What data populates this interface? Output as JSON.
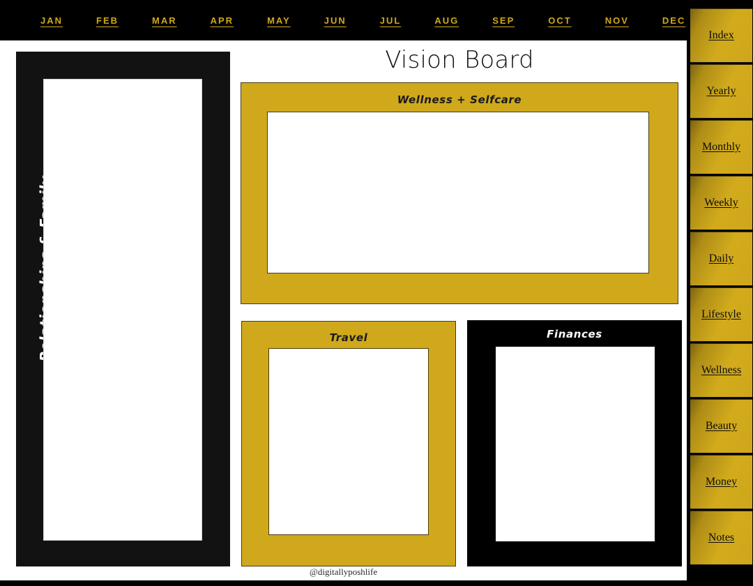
{
  "page": {
    "title": "Vision Board",
    "credit": "@digitallyposhlife"
  },
  "colors": {
    "gold": "#CFA81C",
    "gold_dark": "#7D6410",
    "black": "#000000",
    "panel_black": "#121212",
    "white": "#FFFFFF",
    "month_text": "#D0A81C"
  },
  "month_bar": {
    "months": [
      {
        "label": "JAN"
      },
      {
        "label": "FEB"
      },
      {
        "label": "MAR"
      },
      {
        "label": "APR"
      },
      {
        "label": "MAY"
      },
      {
        "label": "JUN"
      },
      {
        "label": "JUL"
      },
      {
        "label": "AUG"
      },
      {
        "label": "SEP"
      },
      {
        "label": "OCT"
      },
      {
        "label": "NOV"
      },
      {
        "label": "DEC"
      }
    ]
  },
  "side_rail": {
    "tabs": [
      {
        "label": "Index"
      },
      {
        "label": "Yearly"
      },
      {
        "label": "Monthly"
      },
      {
        "label": "Weekly"
      },
      {
        "label": "Daily"
      },
      {
        "label": "Lifestyle"
      },
      {
        "label": "Wellness"
      },
      {
        "label": "Beauty"
      },
      {
        "label": "Money"
      },
      {
        "label": "Notes"
      }
    ]
  },
  "left_panel": {
    "label": "Relationships & Family"
  },
  "cards": [
    {
      "id": "wellness",
      "title": "Wellness + Selfcare",
      "style": "gold"
    },
    {
      "id": "travel",
      "title": "Travel",
      "style": "gold"
    },
    {
      "id": "finances",
      "title": "Finances",
      "style": "black"
    }
  ]
}
